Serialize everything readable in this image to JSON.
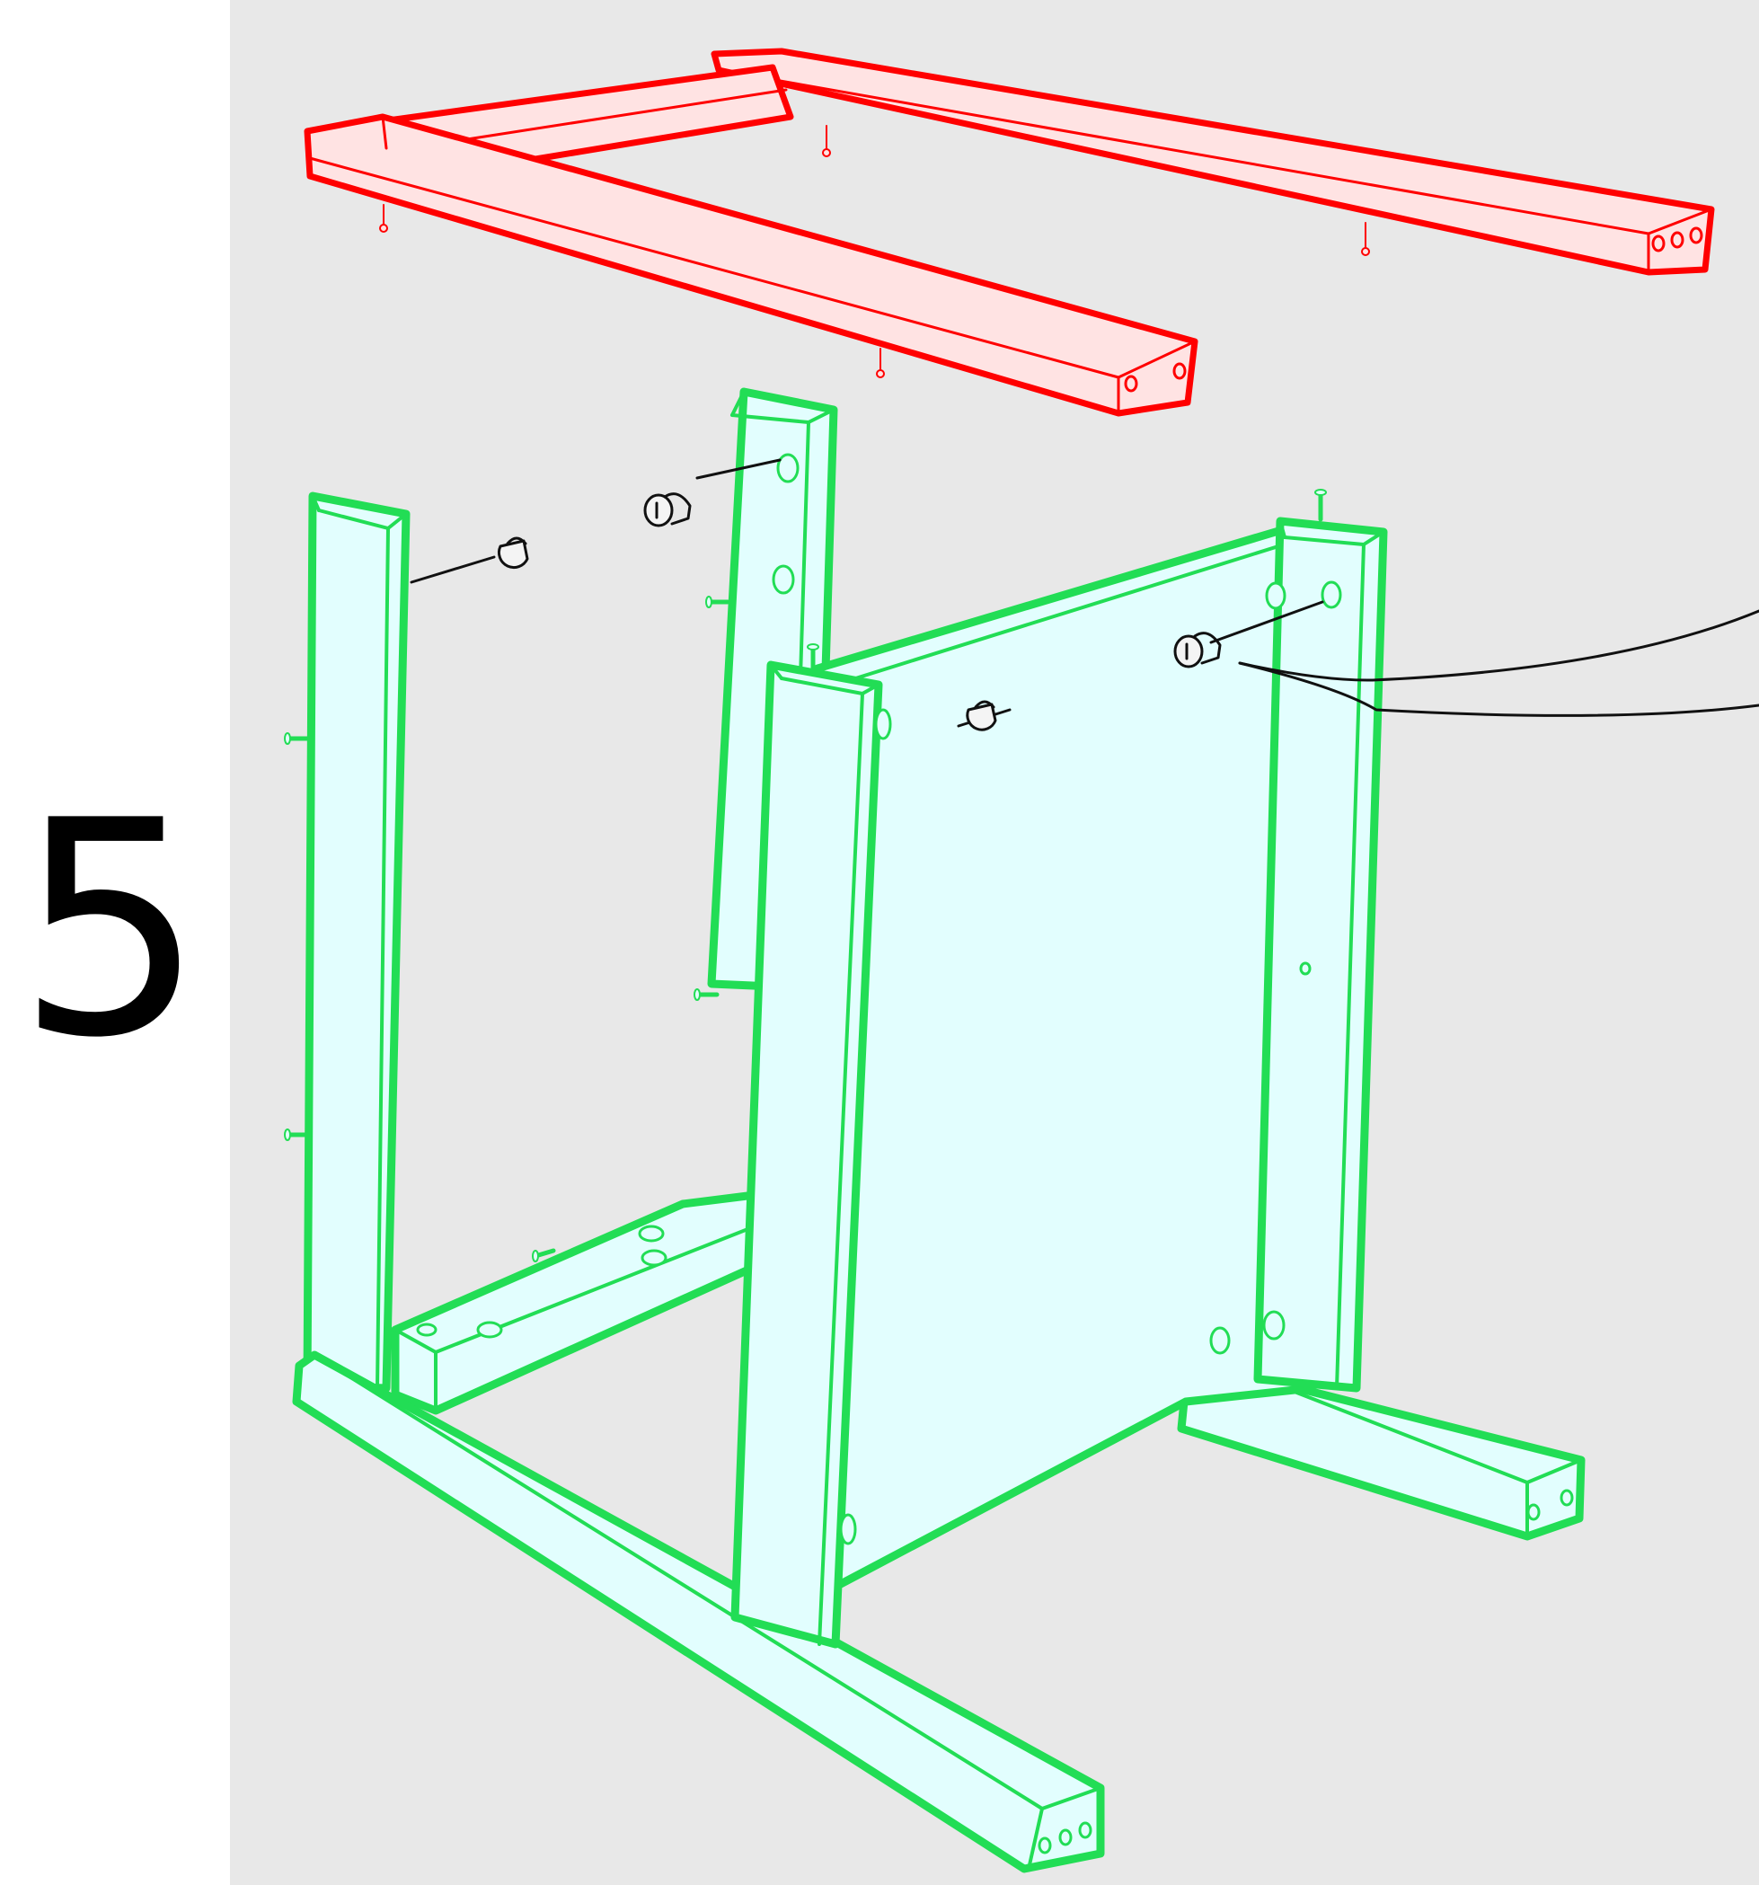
{
  "step": {
    "number": "5"
  },
  "colors": {
    "background": "#e8e8e8",
    "margin": "#ffffff",
    "top_frame_stroke": "#ff0000",
    "top_frame_fill": "#ffe3e3",
    "base_assembly_stroke": "#22dd55",
    "base_assembly_fill": "#e2fefe",
    "hardware_stroke": "#111111"
  },
  "parts": [
    {
      "name": "top-frame",
      "highlight": "red"
    },
    {
      "name": "base-assembly",
      "highlight": "green"
    },
    {
      "name": "cam-lock-fittings",
      "count": 4
    }
  ]
}
